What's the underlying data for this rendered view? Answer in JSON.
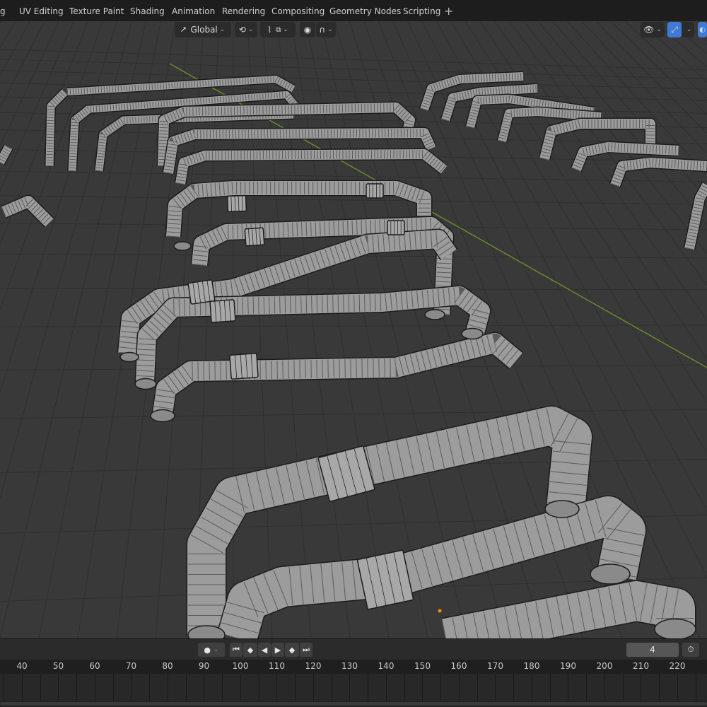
{
  "workspace_tabs": [
    "g",
    "UV Editing",
    "Texture Paint",
    "Shading",
    "Animation",
    "Rendering",
    "Compositing",
    "Geometry Nodes",
    "Scripting"
  ],
  "add_workspace_glyph": "+",
  "viewport_header": {
    "transform_orientation": "Global",
    "chevron": "⌄"
  },
  "timeline": {
    "current_frame": "4",
    "ruler_labels": [
      "40",
      "50",
      "60",
      "70",
      "80",
      "90",
      "100",
      "110",
      "120",
      "130",
      "140",
      "150",
      "160",
      "170",
      "180",
      "190",
      "200",
      "210",
      "220"
    ]
  },
  "colors": {
    "viewport_bg": "#393939",
    "grid_line": "#2f2f2f",
    "axis_y": "#6b8f2a",
    "mesh_fill": "#9c9c9c",
    "wire": "#262626",
    "origin_point": "#ff8c00",
    "accent_blue": "#3f7ad6"
  },
  "icons": [
    "orientation-gizmo-icon",
    "snap-icon",
    "proportional-edit-icon",
    "falloff-icon",
    "visibility-icon",
    "gizmo-toggle-icon",
    "overlay-icon",
    "jump-start-icon",
    "prev-key-icon",
    "play-reverse-icon",
    "play-icon",
    "next-key-icon",
    "jump-end-icon",
    "record-icon",
    "stopwatch-icon"
  ]
}
